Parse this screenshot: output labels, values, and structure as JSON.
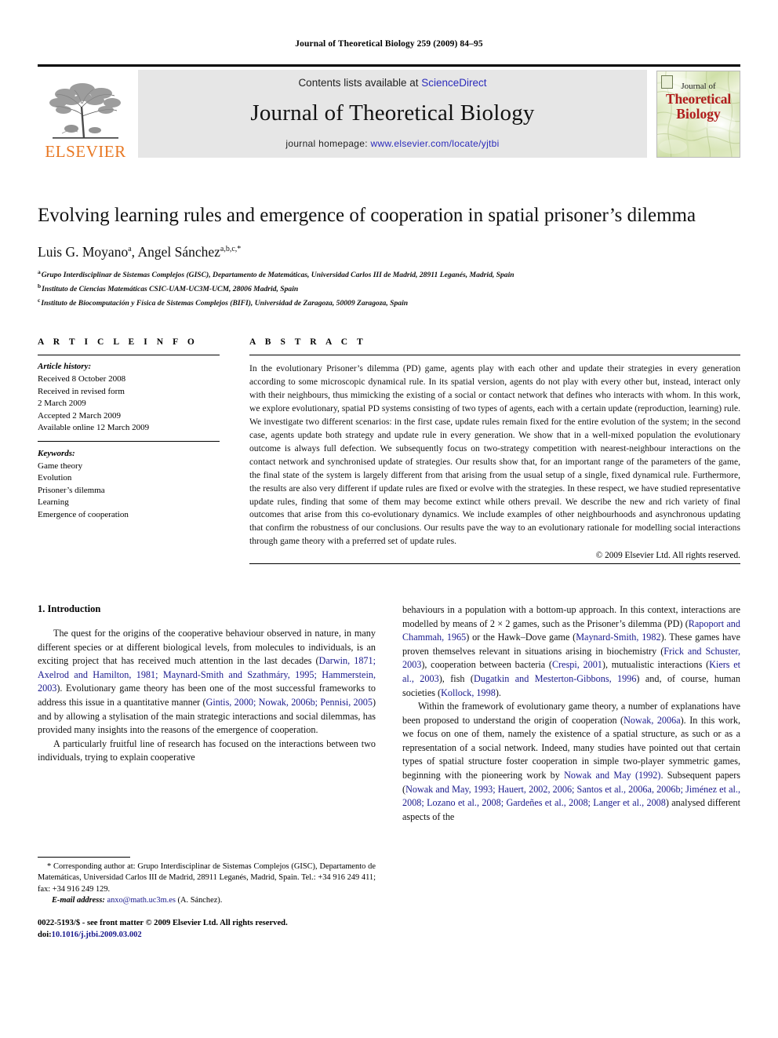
{
  "running_head": "Journal of Theoretical Biology 259 (2009) 84–95",
  "masthead": {
    "contents_prefix": "Contents lists available at ",
    "sciencedirect": "ScienceDirect",
    "journal_name": "Journal of Theoretical Biology",
    "homepage_prefix": "journal homepage: ",
    "homepage_url": "www.elsevier.com/locate/yjtbi",
    "publisher_word": "ELSEVIER",
    "publisher_color": "#E87722",
    "link_color": "#2b2bbb",
    "cover": {
      "line1": "Journal of",
      "line2": "Theoretical",
      "line3": "Biology",
      "title_color": "#b01d1d"
    }
  },
  "title": "Evolving learning rules and emergence of cooperation in spatial prisoner’s dilemma",
  "authors": {
    "full": "Luis G. Moyano a, Angel Sánchez a,b,c,*",
    "author1_name": "Luis G. Moyano",
    "author1_sup": "a",
    "separator": ", ",
    "author2_name": "Angel Sánchez",
    "author2_sup": "a,b,c,*"
  },
  "affiliations": [
    {
      "marker": "a",
      "text": "Grupo Interdisciplinar de Sistemas Complejos (GISC), Departamento de Matemáticas, Universidad Carlos III de Madrid, 28911 Leganés, Madrid, Spain"
    },
    {
      "marker": "b",
      "text": "Instituto de Ciencias Matemáticas CSIC-UAM-UC3M-UCM, 28006 Madrid, Spain"
    },
    {
      "marker": "c",
      "text": "Instituto de Biocomputación y Física de Sistemas Complejos (BIFI), Universidad de Zaragoza, 50009 Zaragoza, Spain"
    }
  ],
  "article_info": {
    "label": "A R T I C L E   I N F O",
    "history_head": "Article history:",
    "history": [
      "Received 8 October 2008",
      "Received in revised form",
      "2 March 2009",
      "Accepted 2 March 2009",
      "Available online 12 March 2009"
    ],
    "keywords_head": "Keywords:",
    "keywords": [
      "Game theory",
      "Evolution",
      "Prisoner’s dilemma",
      "Learning",
      "Emergence of cooperation"
    ]
  },
  "abstract": {
    "label": "A B S T R A C T",
    "text": "In the evolutionary Prisoner’s dilemma (PD) game, agents play with each other and update their strategies in every generation according to some microscopic dynamical rule. In its spatial version, agents do not play with every other but, instead, interact only with their neighbours, thus mimicking the existing of a social or contact network that defines who interacts with whom. In this work, we explore evolutionary, spatial PD systems consisting of two types of agents, each with a certain update (reproduction, learning) rule. We investigate two different scenarios: in the first case, update rules remain fixed for the entire evolution of the system; in the second case, agents update both strategy and update rule in every generation. We show that in a well-mixed population the evolutionary outcome is always full defection. We subsequently focus on two-strategy competition with nearest-neighbour interactions on the contact network and synchronised update of strategies. Our results show that, for an important range of the parameters of the game, the final state of the system is largely different from that arising from the usual setup of a single, fixed dynamical rule. Furthermore, the results are also very different if update rules are fixed or evolve with the strategies. In these respect, we have studied representative update rules, finding that some of them may become extinct while others prevail. We describe the new and rich variety of final outcomes that arise from this co-evolutionary dynamics. We include examples of other neighbourhoods and asynchronous updating that confirm the robustness of our conclusions. Our results pave the way to an evolutionary rationale for modelling social interactions through game theory with a preferred set of update rules.",
    "copyright": "© 2009 Elsevier Ltd. All rights reserved."
  },
  "intro": {
    "heading": "1. Introduction",
    "left_para1_a": "The quest for the origins of the cooperative behaviour observed in nature, in many different species or at different biological levels, from molecules to individuals, is an exciting project that has received much attention in the last decades (",
    "left_para1_cite1": "Darwin, 1871; Axelrod and Hamilton, 1981; Maynard-Smith and Szathmáry, 1995; Hammerstein, 2003",
    "left_para1_b": "). Evolutionary game theory has been one of the most successful frameworks to address this issue in a quantitative manner (",
    "left_para1_cite2": "Gintis, 2000; Nowak, 2006b; Pennisi, 2005",
    "left_para1_c": ") and by allowing a stylisation of the main strategic interactions and social dilemmas, has provided many insights into the reasons of the emergence of cooperation.",
    "left_para2": "A particularly fruitful line of research has focused on the interactions between two individuals, trying to explain cooperative",
    "right_para1_a": "behaviours in a population with a bottom-up approach. In this context, interactions are modelled by means of 2 × 2 games, such as the Prisoner’s dilemma (PD) (",
    "right_para1_cite1": "Rapoport and Chammah, 1965",
    "right_para1_b": ") or the Hawk–Dove game (",
    "right_para1_cite2": "Maynard-Smith, 1982",
    "right_para1_c": "). These games have proven themselves relevant in situations arising in biochemistry (",
    "right_para1_cite3": "Frick and Schuster, 2003",
    "right_para1_d": "), cooperation between bacteria (",
    "right_para1_cite4": "Crespi, 2001",
    "right_para1_e": "), mutualistic interactions (",
    "right_para1_cite5": "Kiers et al., 2003",
    "right_para1_f": "), fish (",
    "right_para1_cite6": "Dugatkin and Mesterton-Gibbons, 1996",
    "right_para1_g": ") and, of course, human societies (",
    "right_para1_cite7": "Kollock, 1998",
    "right_para1_h": ").",
    "right_para2_a": "Within the framework of evolutionary game theory, a number of explanations have been proposed to understand the origin of cooperation (",
    "right_para2_cite1": "Nowak, 2006a",
    "right_para2_b": "). In this work, we focus on one of them, namely the existence of a spatial structure, as such or as a representation of a social network. Indeed, many studies have pointed out that certain types of spatial structure foster cooperation in simple two-player symmetric games, beginning with the pioneering work by ",
    "right_para2_cite2": "Nowak and May (1992)",
    "right_para2_c": ". Subsequent papers (",
    "right_para2_cite3": "Nowak and May, 1993; Hauert, 2002, 2006; Santos et al., 2006a, 2006b; Jiménez et al., 2008; Lozano et al., 2008; Gardeñes et al., 2008; Langer et al., 2008",
    "right_para2_d": ") analysed different aspects of the"
  },
  "footnotes": {
    "corresponding": "* Corresponding author at: Grupo Interdisciplinar de Sistemas Complejos (GISC), Departamento de Matemáticas, Universidad Carlos III de Madrid, 28911 Leganés, Madrid, Spain. Tel.: +34 916 249 411; fax: +34 916 249 129.",
    "email_label": "E-mail address:",
    "email_link": "anxo@math.uc3m.es",
    "email_suffix": " (A. Sánchez).",
    "issn_line": "0022-5193/$ - see front matter © 2009 Elsevier Ltd. All rights reserved.",
    "doi_label": "doi:",
    "doi_value": "10.1016/j.jtbi.2009.03.002"
  }
}
